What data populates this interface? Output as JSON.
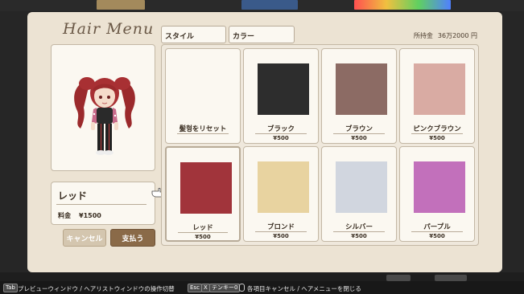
{
  "menu": {
    "title": "Hair Menu",
    "tabs": [
      {
        "label": "スタイル"
      },
      {
        "label": "カラー"
      }
    ],
    "money": {
      "label": "所持金",
      "value": "36万2000 円"
    }
  },
  "selection": {
    "name": "レッド",
    "price_label": "料金",
    "price_value": "¥1500"
  },
  "buttons": {
    "cancel": "キャンセル",
    "pay": "支払う"
  },
  "colors": [
    {
      "label": "髪형をリセット",
      "price": "",
      "hex": ""
    },
    {
      "label": "ブラック",
      "price": "¥500",
      "hex": "#2d2d2d"
    },
    {
      "label": "ブラウン",
      "price": "¥500",
      "hex": "#8c6b64"
    },
    {
      "label": "ピンクブラウン",
      "price": "¥500",
      "hex": "#d9aba3"
    },
    {
      "label": "レッド",
      "price": "¥500",
      "hex": "#a1343b"
    },
    {
      "label": "ブロンド",
      "price": "¥500",
      "hex": "#e8d3a0"
    },
    {
      "label": "シルバー",
      "price": "¥500",
      "hex": "#d1d6df"
    },
    {
      "label": "パープル",
      "price": "¥500",
      "hex": "#c270bb"
    }
  ],
  "help": {
    "tab_key": "Tab",
    "tab_text": "プレビューウィンドウ / ヘアリストウィンドウの操作切替",
    "esc_key": "Esc",
    "x_key": "X",
    "num_key": "テンキー0",
    "esc_text": "各項目キャンセル / ヘアメニューを閉じる"
  }
}
